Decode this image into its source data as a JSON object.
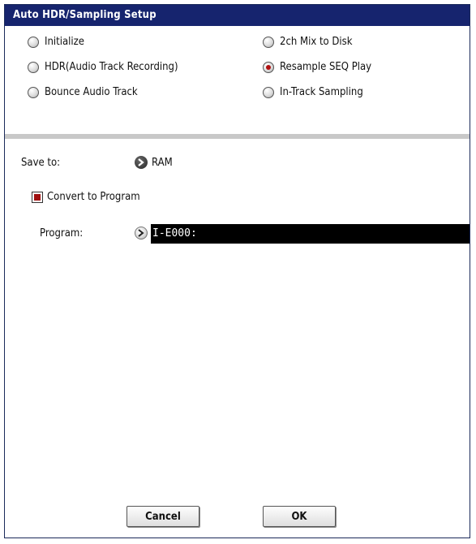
{
  "dialog": {
    "title": "Auto HDR/Sampling Setup"
  },
  "mode_options": [
    {
      "label": "Initialize",
      "selected": false
    },
    {
      "label": "2ch Mix to Disk",
      "selected": false
    },
    {
      "label": "HDR(Audio Track Recording)",
      "selected": false
    },
    {
      "label": "Resample SEQ Play",
      "selected": true
    },
    {
      "label": "Bounce Audio Track",
      "selected": false
    },
    {
      "label": "In-Track Sampling",
      "selected": false
    }
  ],
  "save_to": {
    "label": "Save to:",
    "value": "RAM"
  },
  "convert_to_program": {
    "label": "Convert to Program",
    "checked": true
  },
  "program": {
    "label": "Program:",
    "value": "I-E000:"
  },
  "buttons": {
    "cancel": "Cancel",
    "ok": "OK"
  },
  "colors": {
    "titlebar": "#16246e",
    "radio_selected": "#b01010",
    "checkbox_checked": "#a01010"
  }
}
